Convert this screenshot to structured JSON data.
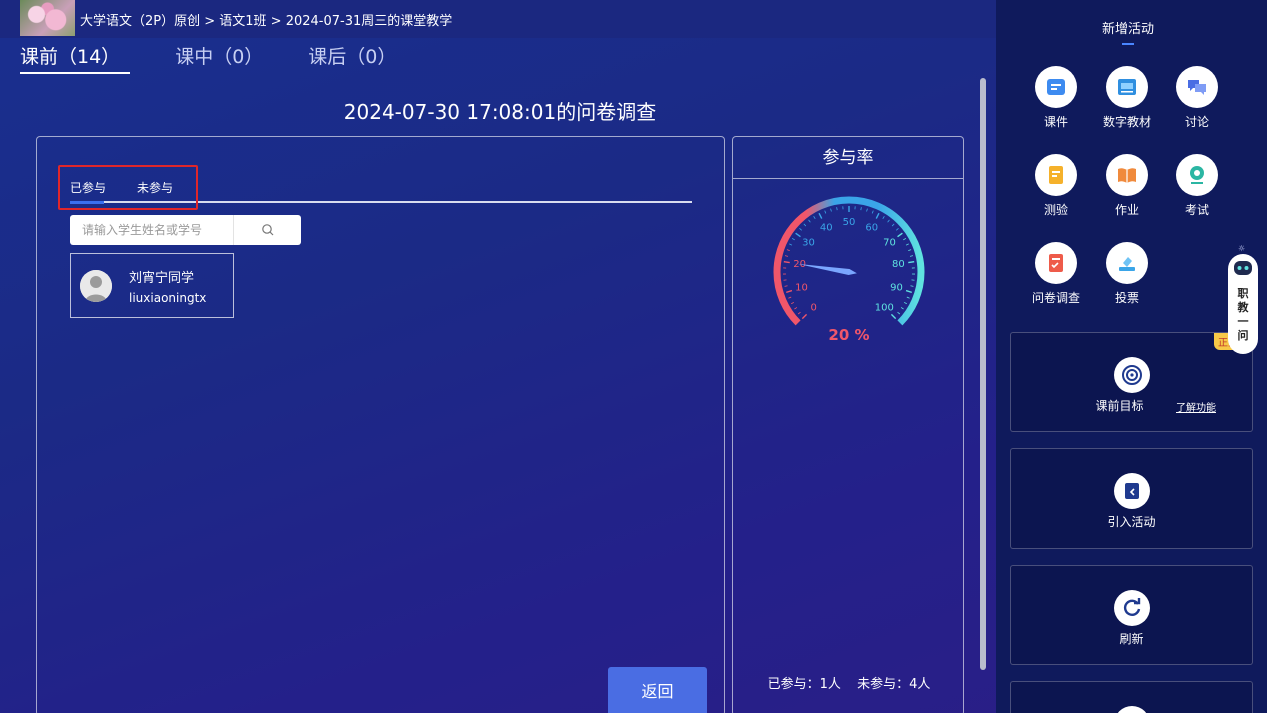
{
  "header": {
    "breadcrumb": "大学语文（2P）原创 > 语文1班 > 2024-07-31周三的课堂教学"
  },
  "tabs": [
    {
      "label": "课前（14）",
      "active": true
    },
    {
      "label": "课中（0）",
      "active": false
    },
    {
      "label": "课后（0）",
      "active": false
    }
  ],
  "survey": {
    "title": "2024-07-30 17:08:01的问卷调查",
    "subtabs": [
      {
        "label": "已参与",
        "active": true
      },
      {
        "label": "未参与",
        "active": false
      }
    ],
    "search_placeholder": "请输入学生姓名或学号",
    "students": [
      {
        "name": "刘宵宁同学",
        "id": "liuxiaoningtx"
      }
    ],
    "back_label": "返回"
  },
  "participation": {
    "title": "参与率",
    "rate_percent": 20,
    "rate_label": "20 %",
    "gauge_ticks": [
      "0",
      "10",
      "20",
      "30",
      "40",
      "50",
      "60",
      "70",
      "80",
      "90",
      "100"
    ],
    "joined_label": "已参与：1人",
    "not_joined_label": "未参与：4人",
    "colors": {
      "low": "#f0566a",
      "mid": "#3aa5e8",
      "high": "#5fe3e0"
    }
  },
  "sidebar": {
    "title": "新增活动",
    "activities": [
      {
        "label": "课件",
        "icon": "courseware-icon"
      },
      {
        "label": "数字教材",
        "icon": "digital-textbook-icon"
      },
      {
        "label": "讨论",
        "icon": "discussion-icon"
      },
      {
        "label": "测验",
        "icon": "quiz-icon"
      },
      {
        "label": "作业",
        "icon": "homework-icon"
      },
      {
        "label": "考试",
        "icon": "exam-icon"
      },
      {
        "label": "问卷调查",
        "icon": "survey-icon"
      },
      {
        "label": "投票",
        "icon": "vote-icon"
      }
    ],
    "goal_card": {
      "label": "课前目标",
      "badge": "正式版",
      "learn_more": "了解功能"
    },
    "import_card": {
      "label": "引入活动"
    },
    "refresh_card": {
      "label": "刷新"
    }
  },
  "assistant": {
    "label": "职教一问"
  }
}
